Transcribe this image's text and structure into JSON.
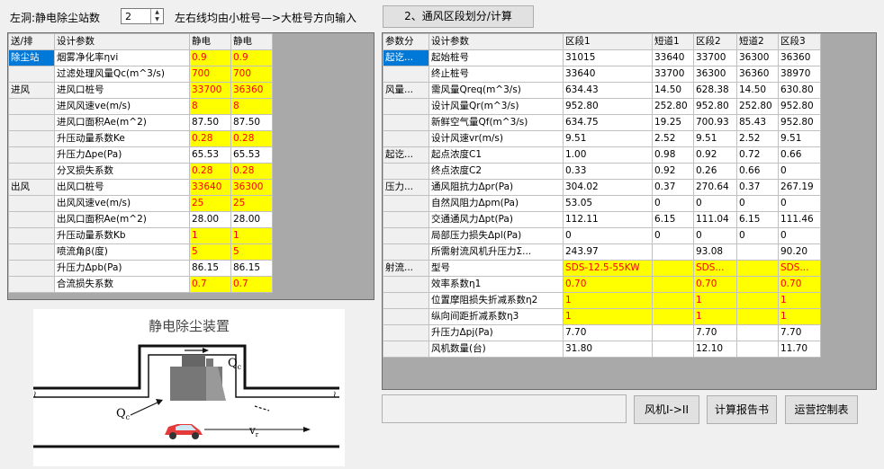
{
  "top": {
    "station_label": "左洞:静电除尘站数",
    "station_count": "2",
    "direction_note": "左右线均由小桩号—>大桩号方向输入",
    "segment_button": "2、通风区段划分/计算"
  },
  "left_table": {
    "headers": [
      "送/排",
      "设计参数",
      "静电",
      "静电"
    ],
    "rows": [
      {
        "group": "除尘站",
        "param": "烟雾净化率ηvi",
        "v1": "0.9",
        "v2": "0.9"
      },
      {
        "group": "",
        "param": "过滤处理风量Qc(m^3/s)",
        "v1": "700",
        "v2": "700"
      },
      {
        "group": "进风",
        "param": "进风口桩号",
        "v1": "33700",
        "v2": "36360"
      },
      {
        "group": "",
        "param": "进风风速ve(m/s)",
        "v1": "8",
        "v2": "8"
      },
      {
        "group": "",
        "param": "进风口面积Ae(m^2)",
        "v1": "87.50",
        "v2": "87.50"
      },
      {
        "group": "",
        "param": "升压动量系数Ke",
        "v1": "0.28",
        "v2": "0.28"
      },
      {
        "group": "",
        "param": "升压力Δpe(Pa)",
        "v1": "65.53",
        "v2": "65.53"
      },
      {
        "group": "",
        "param": "分叉损失系数",
        "v1": "0.28",
        "v2": "0.28"
      },
      {
        "group": "出风",
        "param": "出风口桩号",
        "v1": "33640",
        "v2": "36300"
      },
      {
        "group": "",
        "param": "出风风速ve(m/s)",
        "v1": "25",
        "v2": "25"
      },
      {
        "group": "",
        "param": "出风口面积Ae(m^2)",
        "v1": "28.00",
        "v2": "28.00"
      },
      {
        "group": "",
        "param": "升压动量系数Kb",
        "v1": "1",
        "v2": "1"
      },
      {
        "group": "",
        "param": "喷流角β(度)",
        "v1": "5",
        "v2": "5"
      },
      {
        "group": "",
        "param": "升压力Δpb(Pa)",
        "v1": "86.15",
        "v2": "86.15"
      },
      {
        "group": "",
        "param": "合流损失系数",
        "v1": "0.7",
        "v2": "0.7"
      }
    ]
  },
  "right_table": {
    "headers": [
      "参数分",
      "设计参数",
      "区段1",
      "短道1",
      "区段2",
      "短道2",
      "区段3"
    ],
    "rows": [
      {
        "group": "起讫...",
        "param": "起始桩号",
        "c": [
          "31015",
          "33640",
          "33700",
          "36300",
          "36360"
        ]
      },
      {
        "group": "",
        "param": "终止桩号",
        "c": [
          "33640",
          "33700",
          "36300",
          "36360",
          "38970"
        ]
      },
      {
        "group": "风量...",
        "param": "需风量Qreq(m^3/s)",
        "c": [
          "634.43",
          "14.50",
          "628.38",
          "14.50",
          "630.80"
        ]
      },
      {
        "group": "",
        "param": "设计风量Qr(m^3/s)",
        "c": [
          "952.80",
          "252.80",
          "952.80",
          "252.80",
          "952.80"
        ]
      },
      {
        "group": "",
        "param": "新鲜空气量Qf(m^3/s)",
        "c": [
          "634.75",
          "19.25",
          "700.93",
          "85.43",
          "952.80"
        ]
      },
      {
        "group": "",
        "param": "设计风速vr(m/s)",
        "c": [
          "9.51",
          "2.52",
          "9.51",
          "2.52",
          "9.51"
        ]
      },
      {
        "group": "起讫...",
        "param": "起点浓度C1",
        "c": [
          "1.00",
          "0.98",
          "0.92",
          "0.72",
          "0.66"
        ]
      },
      {
        "group": "",
        "param": "终点浓度C2",
        "c": [
          "0.33",
          "0.92",
          "0.26",
          "0.66",
          "0"
        ]
      },
      {
        "group": "压力...",
        "param": "通风阻抗力Δpr(Pa)",
        "c": [
          "304.02",
          "0.37",
          "270.64",
          "0.37",
          "267.19"
        ]
      },
      {
        "group": "",
        "param": "自然风阻力Δpm(Pa)",
        "c": [
          "53.05",
          "0",
          "0",
          "0",
          "0"
        ]
      },
      {
        "group": "",
        "param": "交通通风力Δpt(Pa)",
        "c": [
          "112.11",
          "6.15",
          "111.04",
          "6.15",
          "111.46"
        ]
      },
      {
        "group": "",
        "param": "局部压力损失Δpl(Pa)",
        "c": [
          "0",
          "0",
          "0",
          "0",
          "0"
        ]
      },
      {
        "group": "",
        "param": "所需射流风机升压力Σ...",
        "c": [
          "243.97",
          "",
          "93.08",
          "",
          "90.20"
        ]
      },
      {
        "group": "射流...",
        "param": "型号",
        "c": [
          "SDS-12.5-55KW",
          "",
          "SDS...",
          "",
          "SDS..."
        ],
        "yellow": true
      },
      {
        "group": "",
        "param": "效率系数η1",
        "c": [
          "0.70",
          "",
          "0.70",
          "",
          "0.70"
        ],
        "yellow": true
      },
      {
        "group": "",
        "param": "位置摩阻损失折减系数η2",
        "c": [
          "1",
          "",
          "1",
          "",
          "1"
        ],
        "yellow": true
      },
      {
        "group": "",
        "param": "纵向间距折减系数η3",
        "c": [
          "1",
          "",
          "1",
          "",
          "1"
        ],
        "yellow": true
      },
      {
        "group": "",
        "param": "升压力Δpj(Pa)",
        "c": [
          "7.70",
          "",
          "7.70",
          "",
          "7.70"
        ]
      },
      {
        "group": "",
        "param": "风机数量(台)",
        "c": [
          "31.80",
          "",
          "12.10",
          "",
          "11.70"
        ]
      }
    ]
  },
  "buttons": {
    "fan_switch": "风机I->II",
    "calc_report": "计算报告书",
    "operation_table": "运营控制表"
  },
  "diagram": {
    "title": "静电除尘装置",
    "qc": "Q",
    "qc_sub": "c",
    "vr": "v",
    "vr_sub": "r"
  },
  "colors": {
    "highlight_yellow": "#ffff00",
    "value_red": "#ff0000",
    "selection_blue": "#0078d7"
  }
}
